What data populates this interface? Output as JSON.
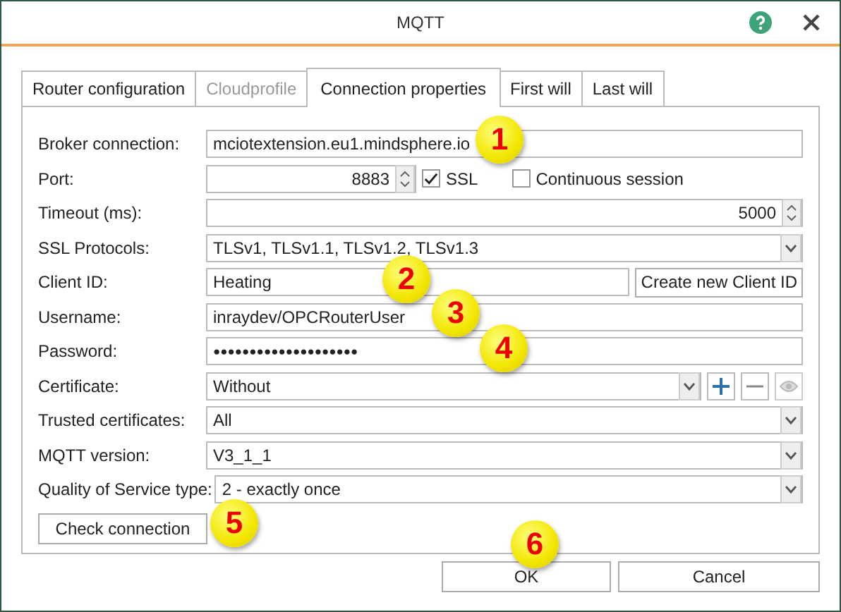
{
  "window": {
    "title": "MQTT"
  },
  "tabs": [
    {
      "label": "Router configuration",
      "selected": false,
      "disabled": false
    },
    {
      "label": "Cloudprofile",
      "selected": false,
      "disabled": true
    },
    {
      "label": "Connection properties",
      "selected": true,
      "disabled": false
    },
    {
      "label": "First will",
      "selected": false,
      "disabled": false
    },
    {
      "label": "Last will",
      "selected": false,
      "disabled": false
    }
  ],
  "rows": [
    {
      "kind": "text",
      "label": "Broker connection:",
      "value": "mciotextension.eu1.mindsphere.io"
    },
    {
      "kind": "port",
      "label": "Port:",
      "value": "8883",
      "checkboxes": [
        {
          "label": "SSL",
          "checked": true
        },
        {
          "label": "Continuous session",
          "checked": false
        }
      ]
    },
    {
      "kind": "spin",
      "label": "Timeout (ms):",
      "value": "5000"
    },
    {
      "kind": "combo",
      "label": "SSL Protocols:",
      "value": "TLSv1, TLSv1.1, TLSv1.2, TLSv1.3"
    },
    {
      "kind": "clientid",
      "label": "Client ID:",
      "value": "Heating",
      "button": "Create new Client ID"
    },
    {
      "kind": "text",
      "label": "Username:",
      "value": "inraydev/OPCRouterUser"
    },
    {
      "kind": "password",
      "label": "Password:",
      "value": "●●●●●●●●●●●●●●●●●●●●"
    },
    {
      "kind": "certificate",
      "label": "Certificate:",
      "value": "Without"
    },
    {
      "kind": "combo",
      "label": "Trusted certificates:",
      "value": "All"
    },
    {
      "kind": "combo",
      "label": "MQTT version:",
      "value": "V3_1_1"
    },
    {
      "kind": "combo",
      "label": "Quality of Service type:",
      "value": "2 - exactly once"
    }
  ],
  "check_button": "Check connection",
  "buttons": [
    "OK",
    "Cancel"
  ],
  "callouts": [
    "1",
    "2",
    "3",
    "4",
    "5",
    "6"
  ]
}
